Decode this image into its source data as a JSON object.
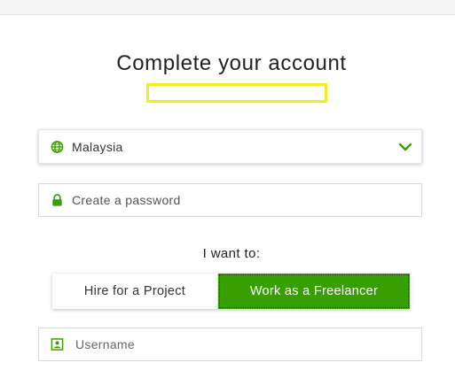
{
  "title": "Complete your account",
  "country_select": {
    "value": "Malaysia",
    "icon": "globe-icon"
  },
  "password": {
    "placeholder": "Create a password",
    "icon": "lock-icon"
  },
  "role": {
    "label": "I want to:",
    "options": [
      "Hire for a Project",
      "Work as a Freelancer"
    ],
    "selected": "Work as a Freelancer"
  },
  "username": {
    "placeholder": "Username",
    "icon": "id-card-icon"
  },
  "colors": {
    "accent": "#37a000",
    "highlight_box": "#f4ef1c"
  }
}
